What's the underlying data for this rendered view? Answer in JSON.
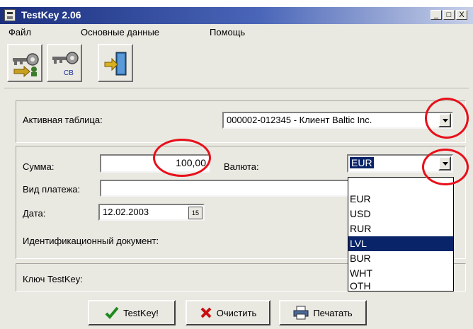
{
  "window": {
    "title": "TestKey 2.06",
    "controls": [
      "_",
      "□",
      "X"
    ]
  },
  "menu": [
    "Файл",
    "Основные данные",
    "Помощь"
  ],
  "toolbar": {
    "buttons": [
      {
        "icon": "key-user-icon",
        "sub": ""
      },
      {
        "icon": "key-cb-icon",
        "sub": "CB"
      },
      {
        "icon": "exit-door-icon",
        "sub": ""
      }
    ]
  },
  "active_table": {
    "label": "Активная таблица:",
    "value": "000002-012345 - Клиент Baltic Inc."
  },
  "form": {
    "sum_label": "Сумма:",
    "sum_value": "100,00",
    "currency_label": "Валюта:",
    "currency_value": "EUR",
    "payment_type_label": "Вид платежа:",
    "payment_type_value": "",
    "date_label": "Дата:",
    "date_value": "12.02.2003",
    "date_button": "15",
    "id_doc_label": "Идентификационный документ:"
  },
  "currency_dropdown": {
    "options": [
      "",
      "EUR",
      "USD",
      "RUR",
      "LVL",
      "BUR",
      "WHT",
      "OTH"
    ],
    "selected": "LVL"
  },
  "key_box": {
    "label": "Ключ TestKey:"
  },
  "buttons": {
    "testkey": "TestKey!",
    "clear": "Очистить",
    "print": "Печатать"
  },
  "colors": {
    "title_bar": "#1b2f7e",
    "selection": "#0a246a",
    "annotation_circle": "#e8101a",
    "window_bg": "#e9e8e1"
  }
}
